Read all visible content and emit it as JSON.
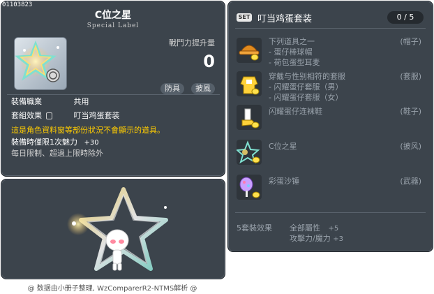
{
  "item": {
    "id": "01103823",
    "title": "C位之星",
    "subtitle": "Special Label",
    "power_label": "戰鬥力提升量",
    "power_value": "0",
    "tags": [
      "防具",
      "披風"
    ],
    "job_label": "裝備職業",
    "job_value": "共用",
    "set_effect_label": "套組效果",
    "set_effect_value": "叮当鸡蛋套装",
    "warning": "這是角色資料窗等部份狀況不會顯示的道具。",
    "charm_text": "裝備時僅限1次魅力",
    "charm_value": "+30",
    "limit_text": "每日限制、超過上限時除外"
  },
  "set": {
    "badge": "SET",
    "name": "叮当鸡蛋套装",
    "count": "0 / 5",
    "items": [
      {
        "lines": [
          "下列道具之一",
          "- 蛋仔棒球帽",
          "- 荷包蛋型耳麦"
        ],
        "slot": "(帽子)",
        "icon": "egg-cap-icon"
      },
      {
        "lines": [
          "穿戴与性别相符的套服",
          "- 闪耀蛋仔套服（男）",
          "- 闪耀蛋仔套服（女）"
        ],
        "slot": "(套服)",
        "icon": "egg-suit-icon"
      },
      {
        "lines": [
          "闪耀蛋仔连袜鞋"
        ],
        "slot": "(鞋子)",
        "icon": "egg-shoes-icon"
      },
      {
        "lines": [
          "C位之星"
        ],
        "slot": "(披风)",
        "icon": "star-cape-icon"
      },
      {
        "lines": [
          "彩蛋沙锤"
        ],
        "slot": "(武器)",
        "icon": "egg-maraca-icon"
      }
    ],
    "bonus_title": "5套裝效果",
    "bonus_lines": [
      {
        "label": "全部屬性",
        "value": "+5"
      },
      {
        "label": "攻擊力/魔力",
        "value": "+3"
      }
    ]
  },
  "footer": "@ 数据由小册子整理, WzComparerR2-NTMS解析 @",
  "colors": {
    "panel_bg": "#3c444c",
    "warning": "#ffcc00",
    "star_glow": "#7fe0d0",
    "star_gold": "#ffe070"
  }
}
